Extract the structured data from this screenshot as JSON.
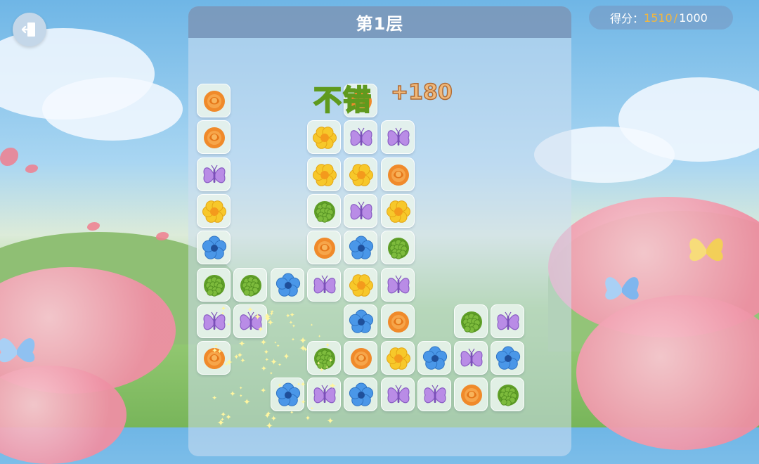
{
  "header": {
    "level_title": "第1层"
  },
  "score": {
    "label": "得分：",
    "current": "1510",
    "separator": "/",
    "target": "1000"
  },
  "feedback": {
    "praise": "不错",
    "bonus": "+180"
  },
  "icon_colors": {
    "orange-rose": "#f08a2a",
    "yellow-flower": "#f7c82a",
    "purple-butterfly": "#b98ce6",
    "blue-flower": "#4a97e8",
    "green-hydrangea": "#7dbb3c"
  },
  "tiles": [
    {
      "col": 0,
      "row": 0,
      "icon": "orange-rose"
    },
    {
      "col": 4,
      "row": 0,
      "icon": "orange-rose"
    },
    {
      "col": 0,
      "row": 1,
      "icon": "orange-rose"
    },
    {
      "col": 3,
      "row": 1,
      "icon": "yellow-flower"
    },
    {
      "col": 4,
      "row": 1,
      "icon": "purple-butterfly"
    },
    {
      "col": 5,
      "row": 1,
      "icon": "purple-butterfly"
    },
    {
      "col": 0,
      "row": 2,
      "icon": "purple-butterfly"
    },
    {
      "col": 3,
      "row": 2,
      "icon": "yellow-flower"
    },
    {
      "col": 4,
      "row": 2,
      "icon": "yellow-flower"
    },
    {
      "col": 5,
      "row": 2,
      "icon": "orange-rose"
    },
    {
      "col": 0,
      "row": 3,
      "icon": "yellow-flower"
    },
    {
      "col": 3,
      "row": 3,
      "icon": "green-hydrangea"
    },
    {
      "col": 4,
      "row": 3,
      "icon": "purple-butterfly"
    },
    {
      "col": 5,
      "row": 3,
      "icon": "yellow-flower"
    },
    {
      "col": 0,
      "row": 4,
      "icon": "blue-flower"
    },
    {
      "col": 3,
      "row": 4,
      "icon": "orange-rose"
    },
    {
      "col": 4,
      "row": 4,
      "icon": "blue-flower"
    },
    {
      "col": 5,
      "row": 4,
      "icon": "green-hydrangea"
    },
    {
      "col": 0,
      "row": 5,
      "icon": "green-hydrangea"
    },
    {
      "col": 1,
      "row": 5,
      "icon": "green-hydrangea"
    },
    {
      "col": 2,
      "row": 5,
      "icon": "blue-flower"
    },
    {
      "col": 3,
      "row": 5,
      "icon": "purple-butterfly"
    },
    {
      "col": 4,
      "row": 5,
      "icon": "yellow-flower"
    },
    {
      "col": 5,
      "row": 5,
      "icon": "purple-butterfly"
    },
    {
      "col": 0,
      "row": 6,
      "icon": "purple-butterfly"
    },
    {
      "col": 1,
      "row": 6,
      "icon": "purple-butterfly"
    },
    {
      "col": 4,
      "row": 6,
      "icon": "blue-flower"
    },
    {
      "col": 5,
      "row": 6,
      "icon": "orange-rose"
    },
    {
      "col": 7,
      "row": 6,
      "icon": "green-hydrangea"
    },
    {
      "col": 8,
      "row": 6,
      "icon": "purple-butterfly"
    },
    {
      "col": 0,
      "row": 7,
      "icon": "orange-rose"
    },
    {
      "col": 3,
      "row": 7,
      "icon": "green-hydrangea"
    },
    {
      "col": 4,
      "row": 7,
      "icon": "orange-rose"
    },
    {
      "col": 5,
      "row": 7,
      "icon": "yellow-flower"
    },
    {
      "col": 6,
      "row": 7,
      "icon": "blue-flower"
    },
    {
      "col": 7,
      "row": 7,
      "icon": "purple-butterfly"
    },
    {
      "col": 8,
      "row": 7,
      "icon": "blue-flower"
    },
    {
      "col": 2,
      "row": 8,
      "icon": "blue-flower"
    },
    {
      "col": 3,
      "row": 8,
      "icon": "purple-butterfly"
    },
    {
      "col": 4,
      "row": 8,
      "icon": "blue-flower"
    },
    {
      "col": 5,
      "row": 8,
      "icon": "purple-butterfly"
    },
    {
      "col": 6,
      "row": 8,
      "icon": "purple-butterfly"
    },
    {
      "col": 7,
      "row": 8,
      "icon": "orange-rose"
    },
    {
      "col": 8,
      "row": 8,
      "icon": "green-hydrangea"
    }
  ]
}
